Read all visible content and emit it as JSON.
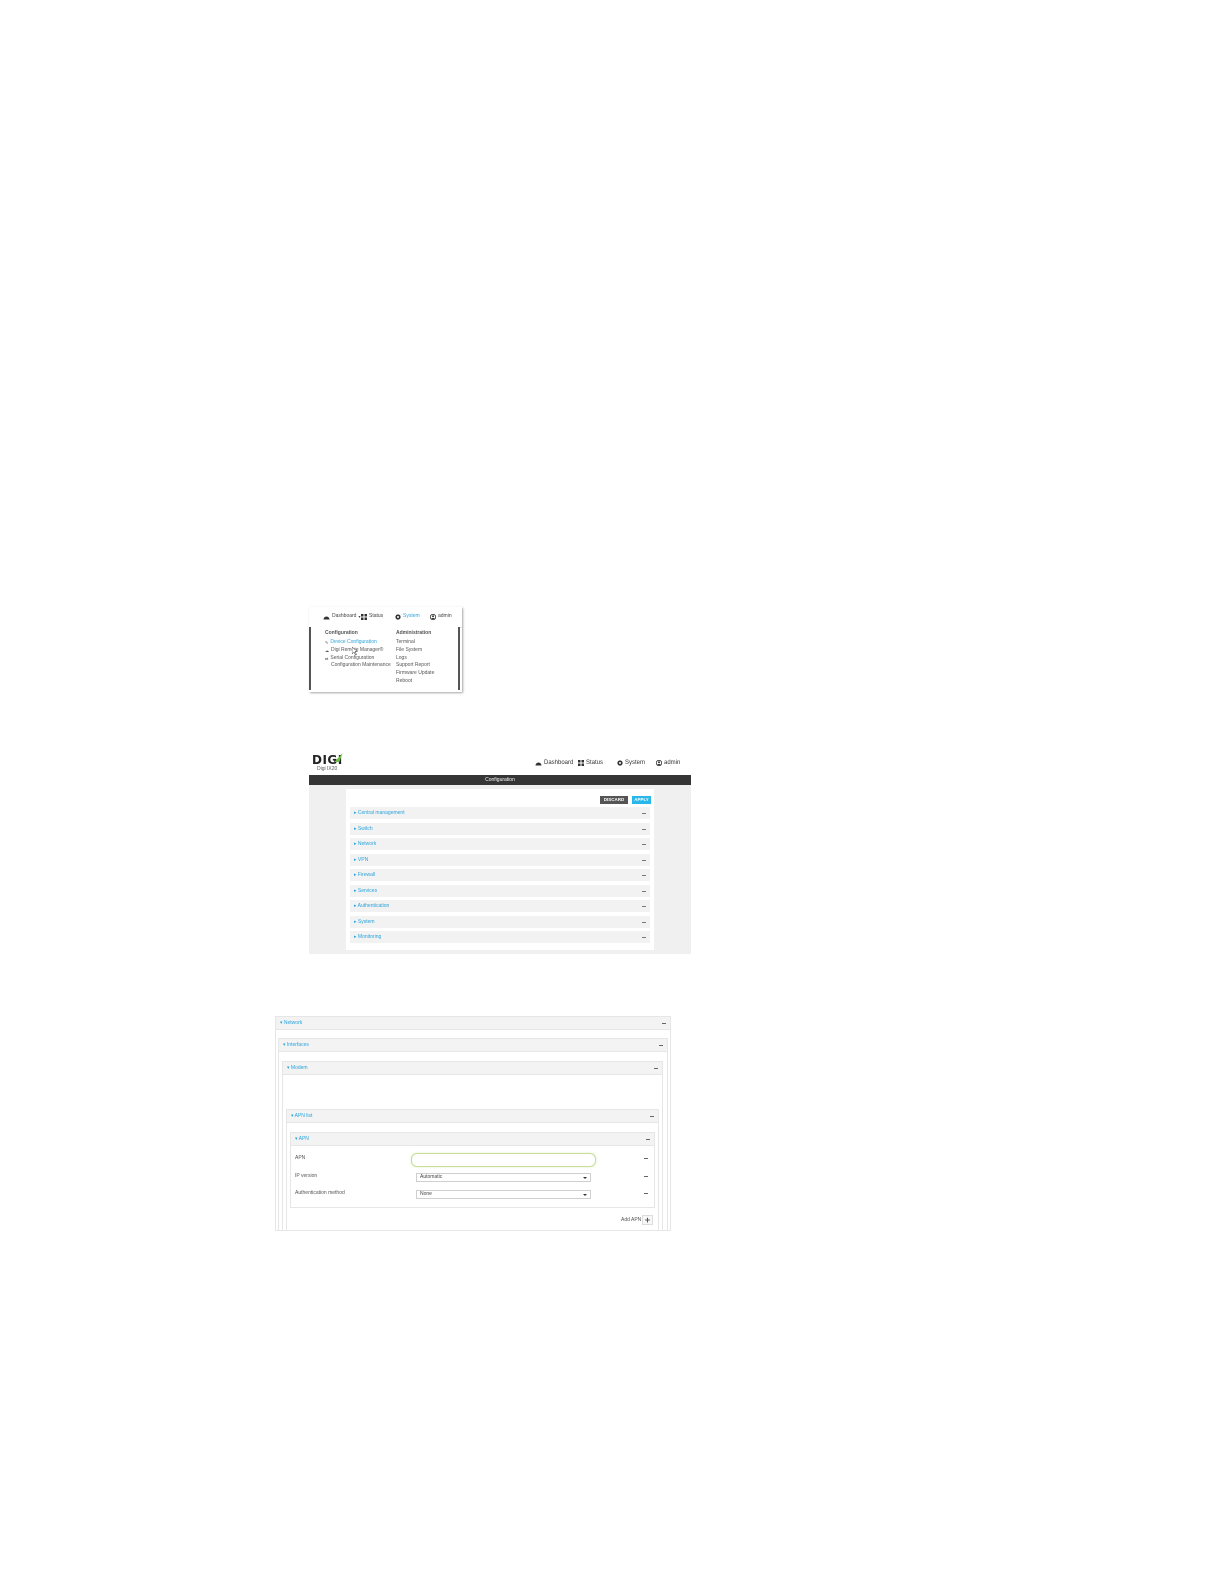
{
  "menu_shot": {
    "nav": {
      "dashboard": "Dashboard",
      "status": "Status",
      "system": "System",
      "admin": "admin"
    },
    "configuration_heading": "Configuration",
    "configuration_items": [
      "Device Configuration",
      "Digi Remote Manager®",
      "Serial Configuration",
      "Configuration Maintenance"
    ],
    "administration_heading": "Administration",
    "administration_items": [
      "Terminal",
      "File System",
      "Logs",
      "Support Report",
      "Firmware Update",
      "Reboot"
    ],
    "colors": {
      "link": "#29a3dc"
    }
  },
  "config_shot": {
    "logo_text": "DIGI",
    "logo_sub": "Digi IX20",
    "nav": {
      "dashboard": "Dashboard",
      "status": "Status",
      "system": "System",
      "admin": "admin"
    },
    "title": "Configuration",
    "discard_label": "DISCARD ALL",
    "apply_label": "APPLY",
    "sections": [
      "Central management",
      "Switch",
      "Network",
      "VPN",
      "Firewall",
      "Services",
      "Authentication",
      "System",
      "Monitoring"
    ],
    "colors": {
      "title_bar": "#353535",
      "apply": "#29b6e8",
      "discard": "#555555",
      "accent": "#6cbd45"
    }
  },
  "network_shot": {
    "network_label": "Network",
    "interfaces_label": "Interfaces",
    "modem_label": "Modem",
    "apn_list_label": "APN list",
    "apn_label": "APN",
    "fields": {
      "apn_label": "APN",
      "apn_value": "",
      "ip_version_label": "IP version",
      "ip_version_value": "Automatic",
      "auth_label": "Authentication method",
      "auth_value": "None"
    },
    "add_apn_label": "Add APN"
  }
}
